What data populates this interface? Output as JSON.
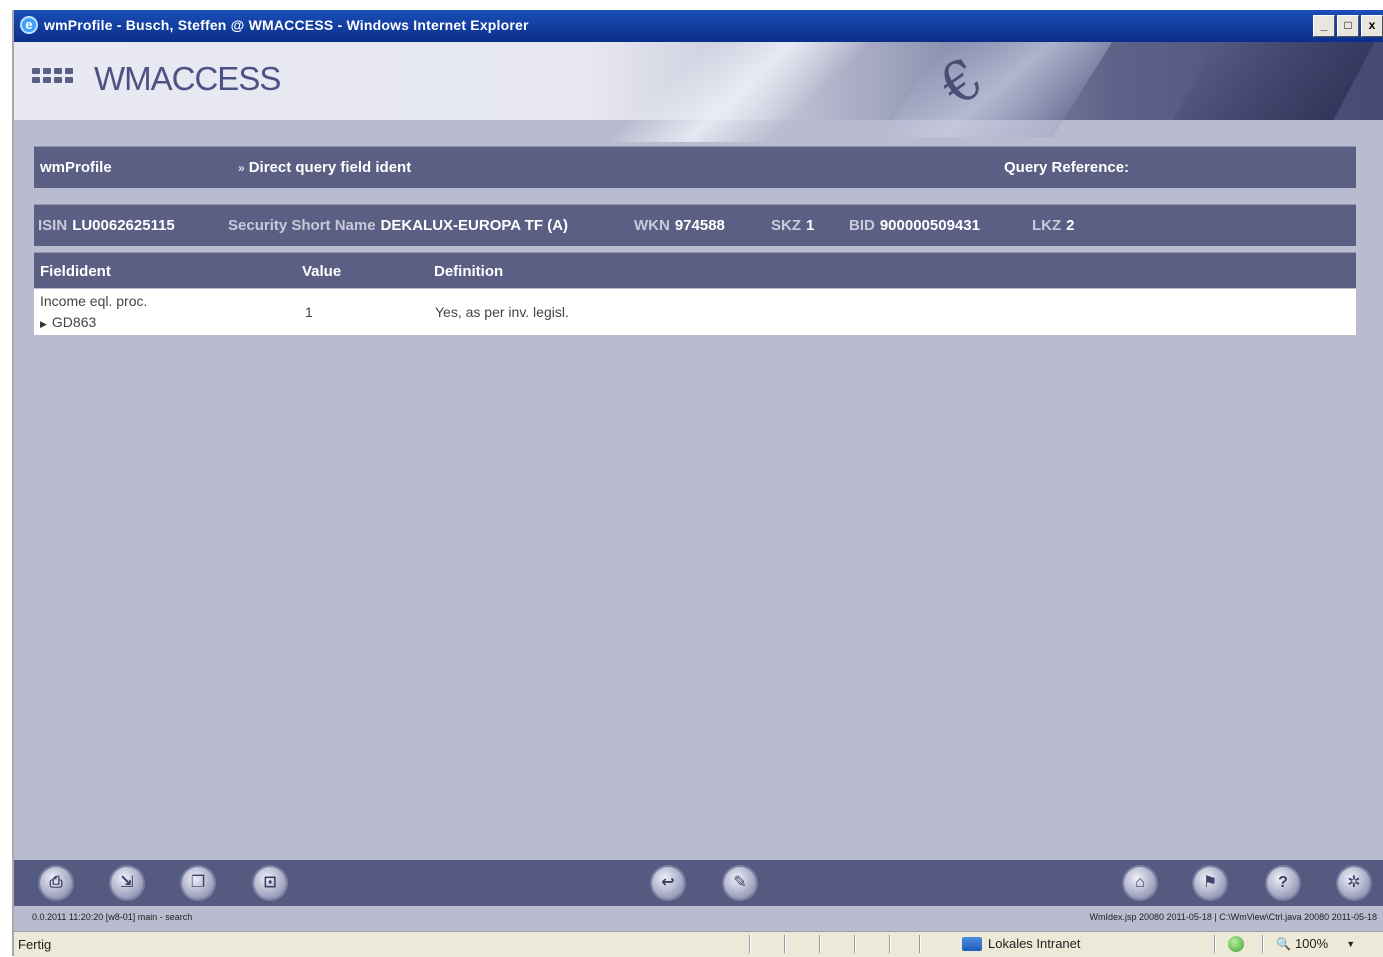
{
  "window": {
    "title": "wmProfile - Busch, Steffen @ WMACCESS - Windows Internet Explorer",
    "buttons": [
      "_",
      "□",
      "x"
    ]
  },
  "banner": {
    "logo_text": "WMACCESS"
  },
  "header": {
    "app_name": "wmProfile",
    "breadcrumb": "Direct query field ident",
    "query_reference_label": "Query Reference:"
  },
  "security": {
    "isin_label": "ISIN",
    "isin": "LU0062625115",
    "short_name_label": "Security Short Name",
    "short_name": "DEKALUX-EUROPA TF (A)",
    "wkn_label": "WKN",
    "wkn": "974588",
    "skz_label": "SKZ",
    "skz": "1",
    "bid_label": "BID",
    "bid": "900000509431",
    "lkz_label": "LKZ",
    "lkz": "2"
  },
  "table": {
    "columns": [
      "Fieldident",
      "Value",
      "Definition"
    ],
    "rows": [
      {
        "field_name": "Income eql. proc.",
        "field_code": "GD863",
        "value": "1",
        "definition": "Yes, as per inv. legisl."
      }
    ]
  },
  "toolbar": {
    "icons": [
      "print-icon",
      "export-icon",
      "copy-icon",
      "save-icon",
      "back-icon",
      "edit-icon",
      "home-icon",
      "bookmark-icon",
      "help-icon",
      "settings-icon"
    ]
  },
  "status_line": {
    "left": "0.0.2011 11:20:20 [w8-01] main - search",
    "right": "WmIdex.jsp 20080 2011-05-18 | C:\\WmView\\Ctrl.java 20080 2011-05-18"
  },
  "ie_status": {
    "ready": "Fertig",
    "zone": "Lokales Intranet",
    "zoom": "100%"
  }
}
